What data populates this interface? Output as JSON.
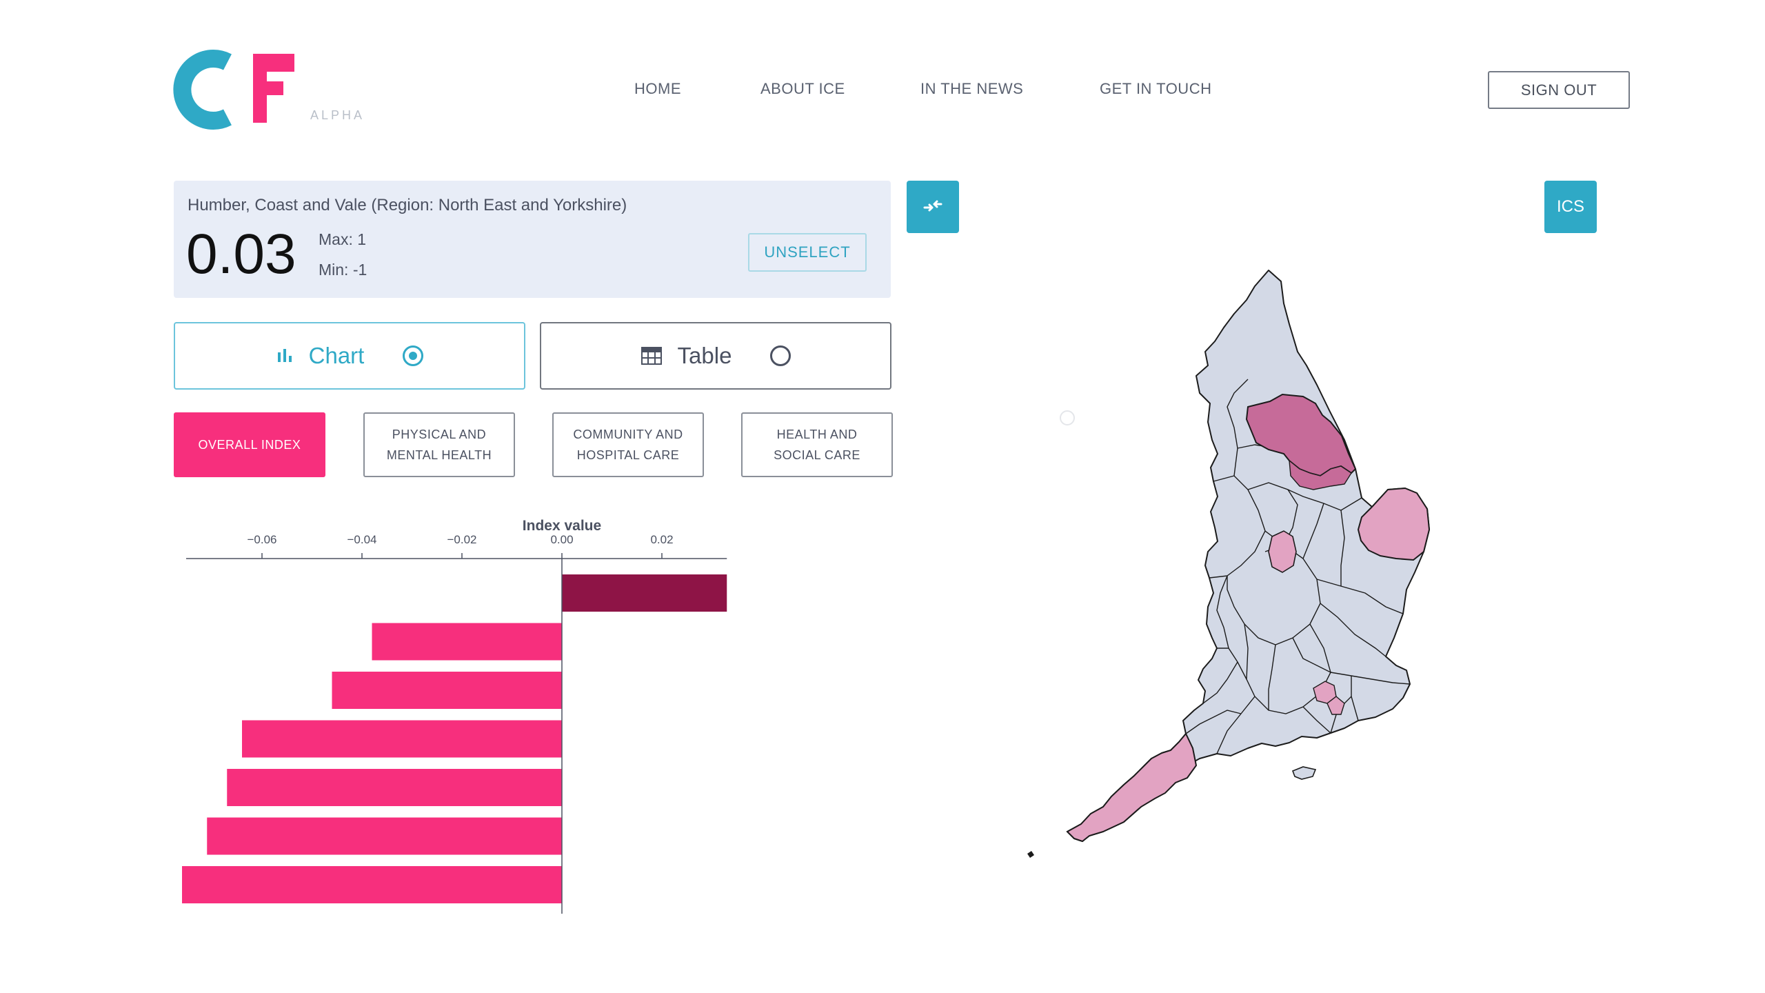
{
  "header": {
    "logo_text": "CF",
    "logo_tag": "ALPHA",
    "nav": [
      "HOME",
      "ABOUT ICE",
      "IN THE NEWS",
      "GET IN TOUCH"
    ],
    "sign_out": "SIGN OUT"
  },
  "info": {
    "region": "Humber, Coast and Vale (Region: North East and Yorkshire)",
    "value": "0.03",
    "max": "Max: 1",
    "min": "Min: -1",
    "unselect": "UNSELECT"
  },
  "buttons": {
    "swap_icon": "swap-arrows-icon",
    "ics": "ICS"
  },
  "view": {
    "chart_label": "Chart",
    "table_label": "Table",
    "selected": "chart"
  },
  "categories": [
    {
      "line1": "OVERALL INDEX",
      "line2": "",
      "active": true
    },
    {
      "line1": "PHYSICAL AND",
      "line2": "MENTAL HEALTH",
      "active": false
    },
    {
      "line1": "COMMUNITY AND",
      "line2": "HOSPITAL CARE",
      "active": false
    },
    {
      "line1": "HEALTH AND",
      "line2": "SOCIAL CARE",
      "active": false
    }
  ],
  "colors": {
    "accent": "#2fa9c6",
    "pink": "#f72f7d",
    "dark_bar": "#8e1446",
    "map_base": "#d3d9e6",
    "map_high": "#c66b99",
    "map_mid": "#e2a3c2"
  },
  "chart_data": {
    "type": "bar",
    "orientation": "horizontal",
    "title": "Index value",
    "xticks": [
      -0.06,
      -0.04,
      -0.02,
      0.0,
      0.02
    ],
    "xtick_labels": [
      "−0.06",
      "−0.04",
      "−0.02",
      "0.00",
      "0.02"
    ],
    "xlim": [
      -0.076,
      0.033
    ],
    "values": [
      0.033,
      -0.038,
      -0.046,
      -0.064,
      -0.067,
      -0.071,
      -0.076
    ],
    "highlight_index": 0
  },
  "map": {
    "type": "choropleth",
    "highlighted": "Humber, Coast and Vale"
  }
}
